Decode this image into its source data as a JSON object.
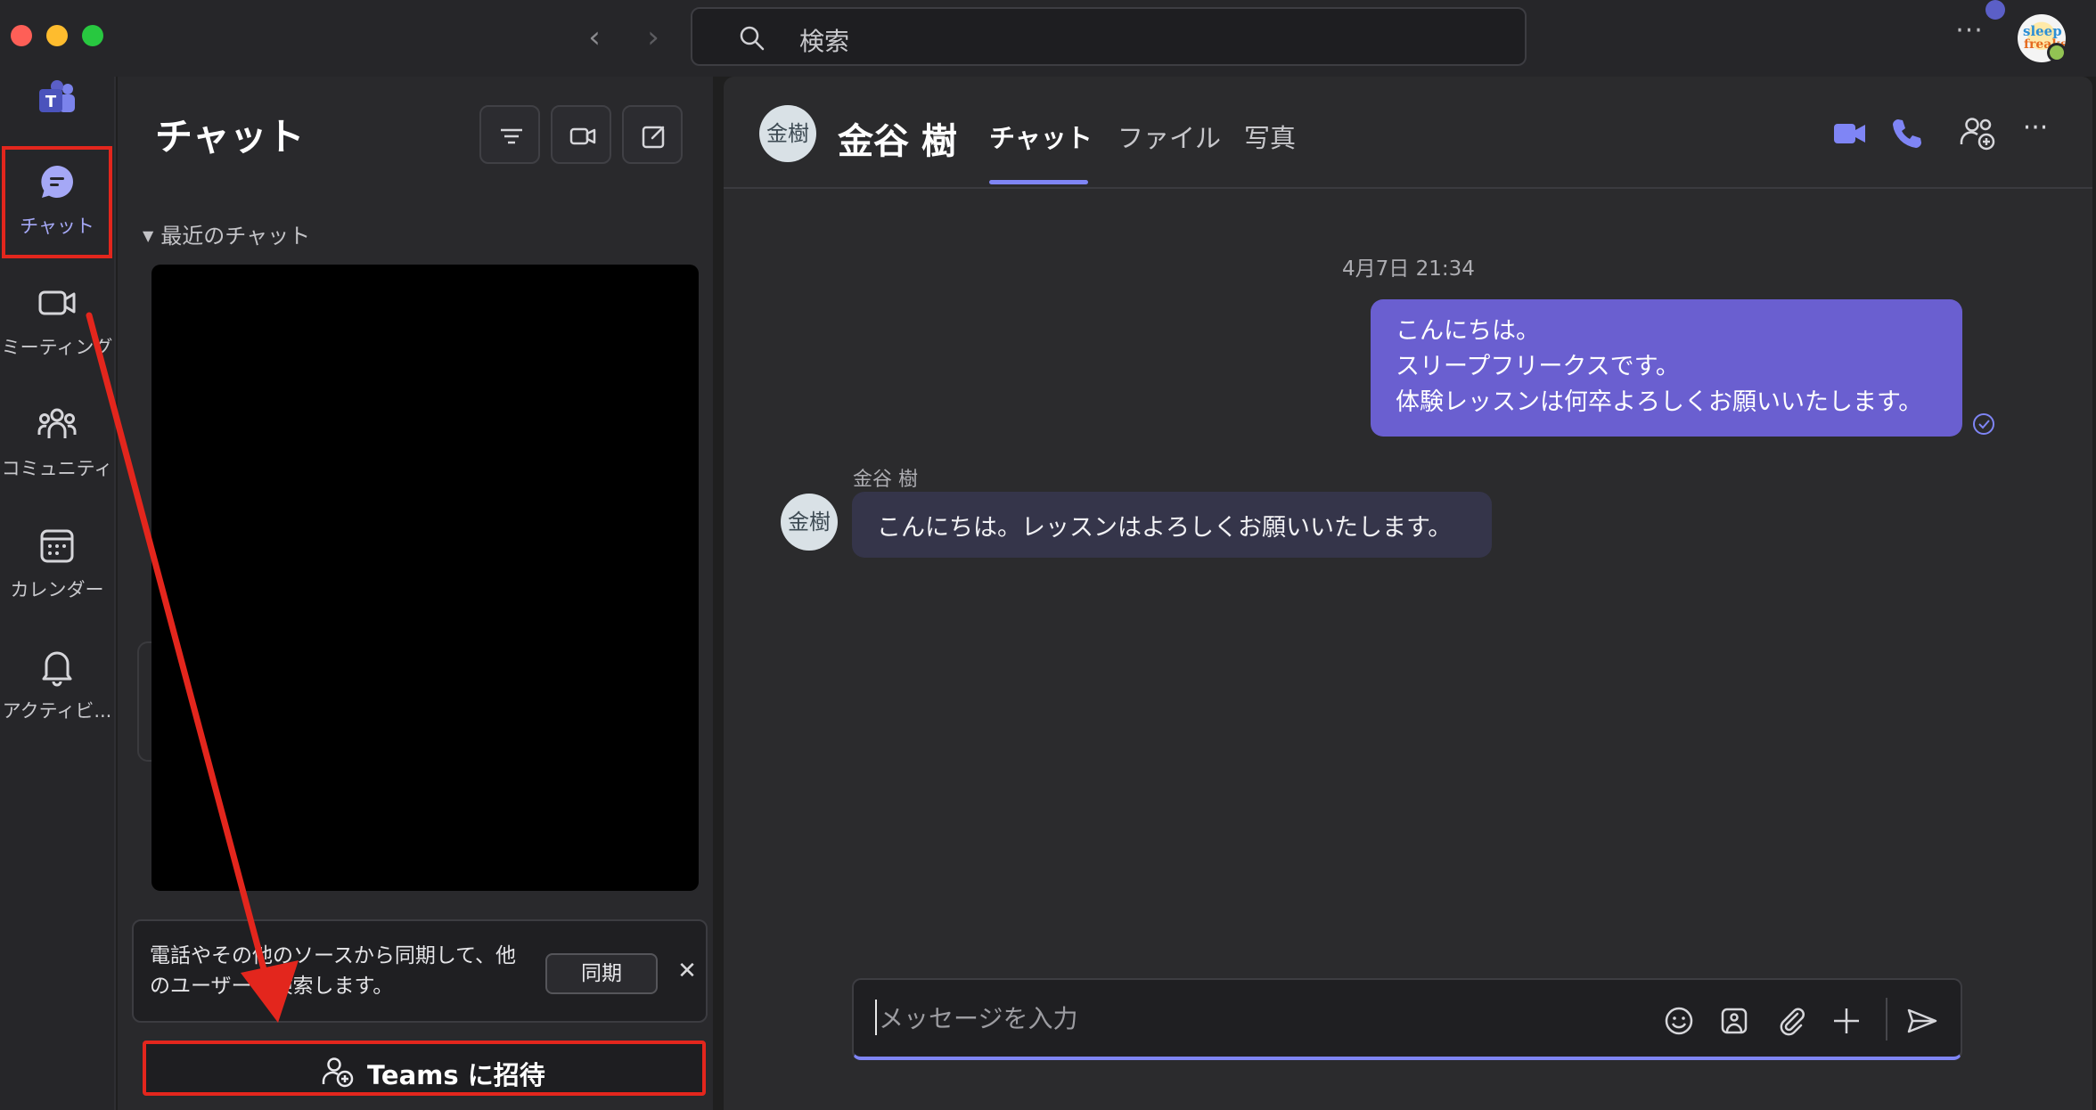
{
  "window": {
    "search_placeholder": "検索"
  },
  "rail": {
    "items": [
      {
        "label": "チャット",
        "icon": "chat-icon",
        "active": true
      },
      {
        "label": "ミーティング",
        "icon": "video-camera-icon"
      },
      {
        "label": "コミュニティ",
        "icon": "community-icon"
      },
      {
        "label": "カレンダー",
        "icon": "calendar-icon"
      },
      {
        "label": "アクティビ...",
        "icon": "bell-icon"
      }
    ]
  },
  "chat_list": {
    "title": "チャット",
    "recent_label": "最近のチャット",
    "sync_card": {
      "text": "電話やその他のソースから同期して、他のユーザーを検索します。",
      "button": "同期"
    },
    "invite_button": "Teams に招待"
  },
  "conversation": {
    "contact_initials": "金樹",
    "contact_name": "金谷 樹",
    "tabs": [
      "チャット",
      "ファイル",
      "写真"
    ],
    "active_tab": "チャット",
    "timestamp": "4月7日 21:34",
    "my_message_lines": [
      "こんにちは。",
      "スリープフリークスです。",
      "体験レッスンは何卒よろしくお願いいたします。"
    ],
    "their_sender": "金谷 樹",
    "their_message": "こんにちは。レッスンはよろしくお願いいたします。",
    "compose_placeholder": "メッセージを入力"
  },
  "colors": {
    "accent": "#7f85f5",
    "my_bubble": "#6a5fd0",
    "their_bubble": "#35354a",
    "annotation_red": "#e3261d"
  }
}
